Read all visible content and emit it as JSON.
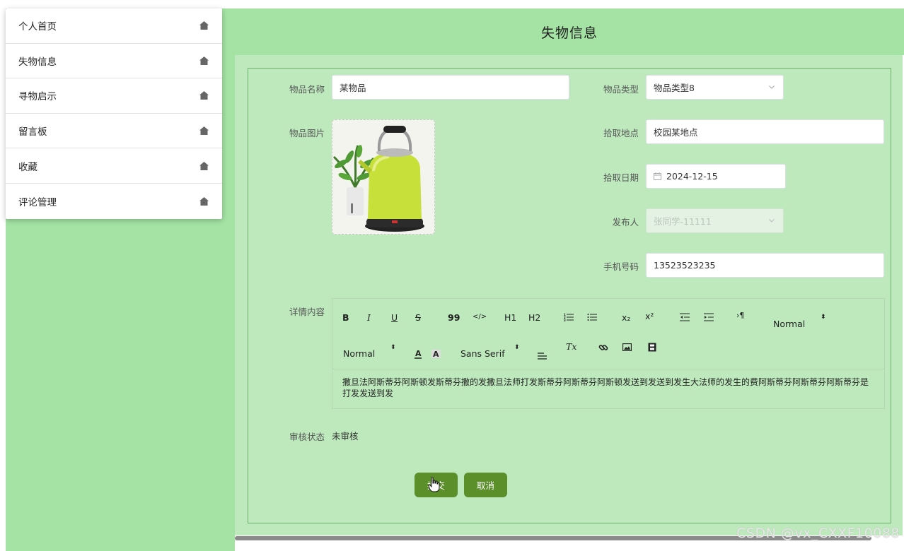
{
  "sidebar": {
    "items": [
      {
        "label": "个人首页",
        "icon": "home-icon"
      },
      {
        "label": "失物信息",
        "icon": "home-icon"
      },
      {
        "label": "寻物启示",
        "icon": "home-icon"
      },
      {
        "label": "留言板",
        "icon": "home-icon"
      },
      {
        "label": "收藏",
        "icon": "home-icon"
      },
      {
        "label": "评论管理",
        "icon": "home-icon"
      }
    ]
  },
  "header": {
    "title": "失物信息"
  },
  "form": {
    "item_name_label": "物品名称",
    "item_name_value": "某物品",
    "item_type_label": "物品类型",
    "item_type_value": "物品类型8",
    "item_image_label": "物品图片",
    "pickup_place_label": "拾取地点",
    "pickup_place_value": "校园某地点",
    "pickup_date_label": "拾取日期",
    "pickup_date_value": "2024-12-15",
    "publisher_label": "发布人",
    "publisher_value": "张同学-11111",
    "phone_label": "手机号码",
    "phone_value": "13523523235",
    "detail_label": "详情内容",
    "detail_text": "撒旦法阿斯蒂芬阿斯顿发斯蒂芬撒的发撒旦法师打发斯蒂芬阿斯蒂芬阿斯顿发送到发送到发生大法师的发生的费阿斯蒂芬阿斯蒂芬阿斯蒂芬是打发发送到发",
    "review_label": "审核状态",
    "review_value": "未审核"
  },
  "toolbar": {
    "bold": "B",
    "italic": "I",
    "underline": "U",
    "strike": "S",
    "quote": "99",
    "code": "</>",
    "h1": "H1",
    "h2": "H2",
    "sub": "x₂",
    "sup": "x²",
    "size_value": "Normal",
    "header_value": "Normal",
    "font_value": "Sans Serif",
    "clean": "Tx"
  },
  "buttons": {
    "submit": "提交",
    "cancel": "取消"
  },
  "watermark": "CSDN @vx_CXXF10088",
  "colors": {
    "accent": "#5a8f2a",
    "header_bg": "#a4e3a4",
    "main_bg": "#bde9bd"
  }
}
